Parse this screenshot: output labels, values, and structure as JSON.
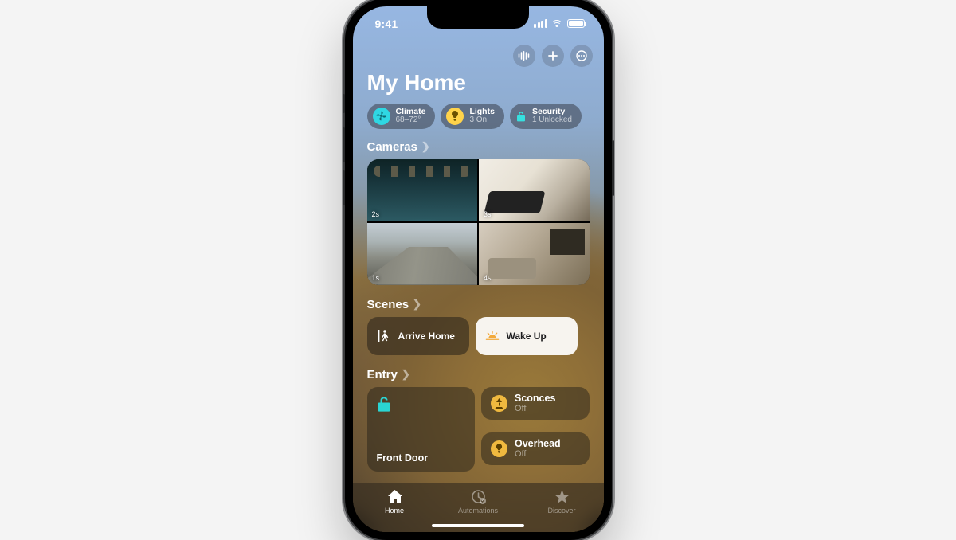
{
  "status": {
    "time": "9:41"
  },
  "header": {
    "title": "My Home",
    "actions": {
      "announce": "announce",
      "add": "add",
      "more": "more"
    }
  },
  "categories": [
    {
      "id": "climate",
      "label": "Climate",
      "detail": "68–72°"
    },
    {
      "id": "lights",
      "label": "Lights",
      "detail": "3 On"
    },
    {
      "id": "security",
      "label": "Security",
      "detail": "1 Unlocked"
    }
  ],
  "sections": {
    "cameras": {
      "title": "Cameras",
      "feeds": [
        {
          "id": "pool",
          "ago": "2s"
        },
        {
          "id": "gym",
          "ago": "3s"
        },
        {
          "id": "drive",
          "ago": "1s"
        },
        {
          "id": "living",
          "ago": "4s"
        }
      ]
    },
    "scenes": {
      "title": "Scenes",
      "items": [
        {
          "id": "arrive",
          "label": "Arrive Home",
          "active": false
        },
        {
          "id": "wakeup",
          "label": "Wake Up",
          "active": true
        }
      ]
    },
    "entry": {
      "title": "Entry",
      "tiles": {
        "front_door": {
          "name": "Front Door"
        },
        "sconces": {
          "name": "Sconces",
          "state": "Off"
        },
        "overhead": {
          "name": "Overhead",
          "state": "Off"
        }
      }
    }
  },
  "tabs": [
    {
      "id": "home",
      "label": "Home",
      "active": true
    },
    {
      "id": "automations",
      "label": "Automations",
      "active": false
    },
    {
      "id": "discover",
      "label": "Discover",
      "active": false
    }
  ]
}
